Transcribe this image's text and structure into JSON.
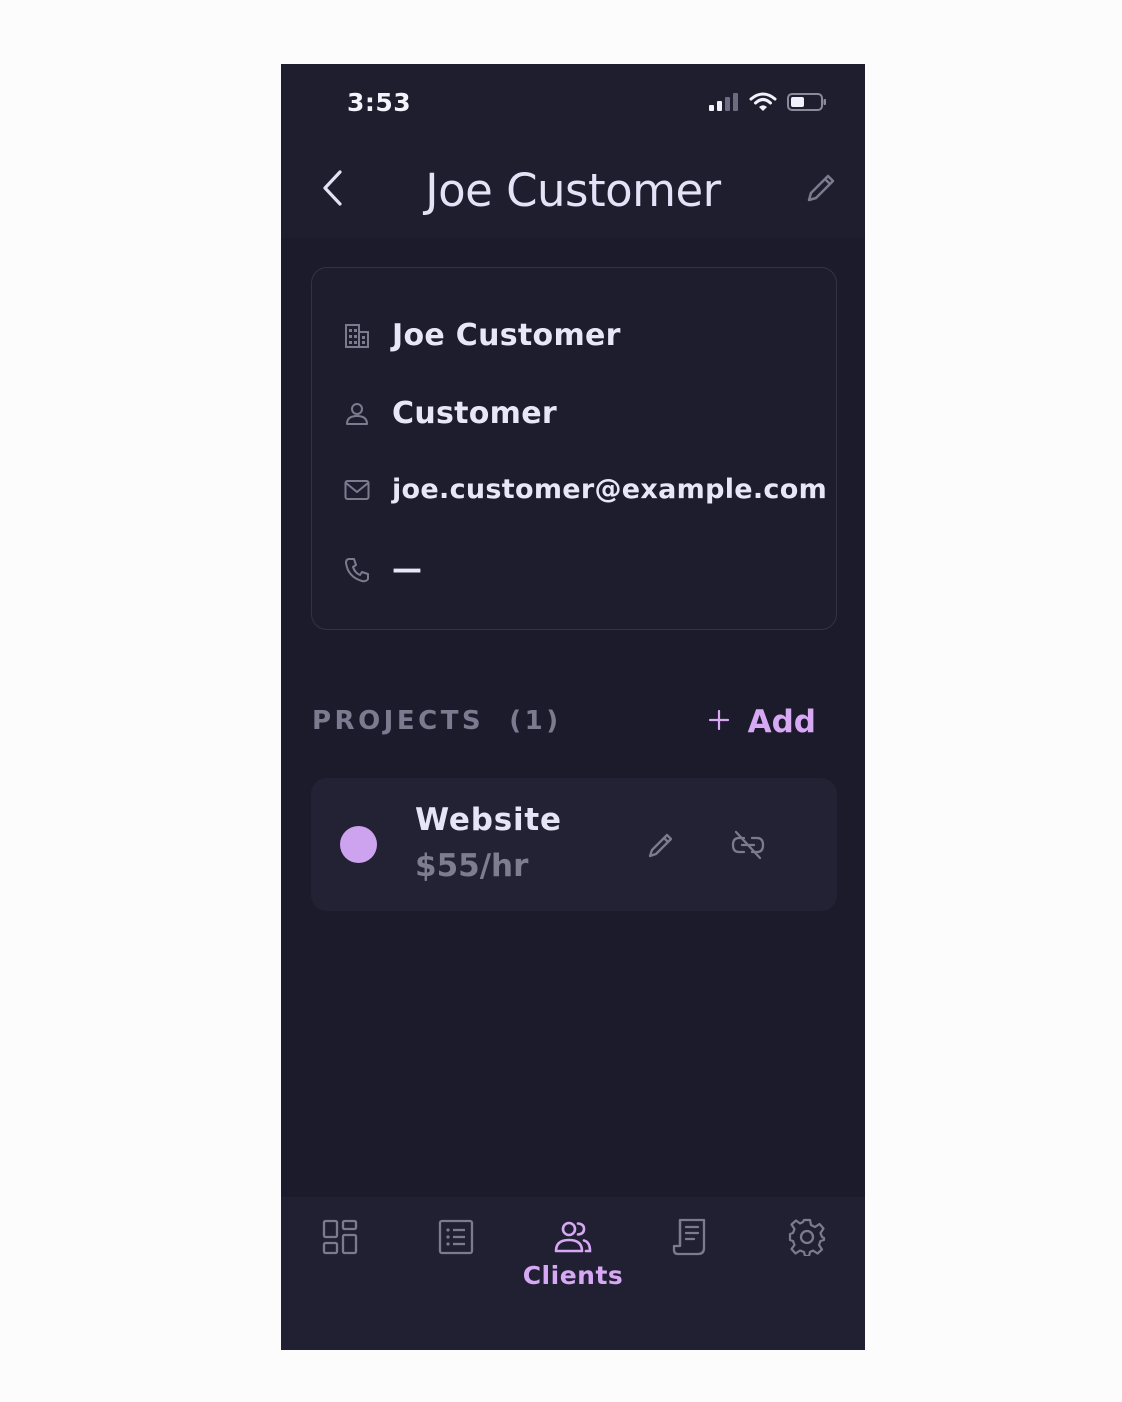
{
  "status_bar": {
    "time": "3:53",
    "icons": [
      "signal-icon",
      "wifi-icon",
      "battery-icon"
    ]
  },
  "header": {
    "title": "Joe Customer",
    "back_icon": "chevron-left-icon",
    "edit_icon": "pencil-icon"
  },
  "client_info": {
    "company": "Joe Customer",
    "contact": "Customer",
    "email": "joe.customer@example.com",
    "phone": "—"
  },
  "projects": {
    "label": "PROJECTS  (1)",
    "add_label": "Add",
    "items": [
      {
        "name": "Website",
        "rate": "$55/hr",
        "color": "#cda3ef"
      }
    ]
  },
  "tabbar": {
    "active": "clients",
    "items": [
      {
        "id": "dashboard",
        "label": "",
        "icon": "dashboard-icon"
      },
      {
        "id": "list",
        "label": "",
        "icon": "list-icon"
      },
      {
        "id": "clients",
        "label": "Clients",
        "icon": "users-icon"
      },
      {
        "id": "invoices",
        "label": "",
        "icon": "receipt-icon"
      },
      {
        "id": "settings",
        "label": "",
        "icon": "gear-icon"
      }
    ]
  },
  "colors": {
    "background": "#1c1b2b",
    "accent": "#d7a8f4",
    "muted": "#7d7a90"
  }
}
